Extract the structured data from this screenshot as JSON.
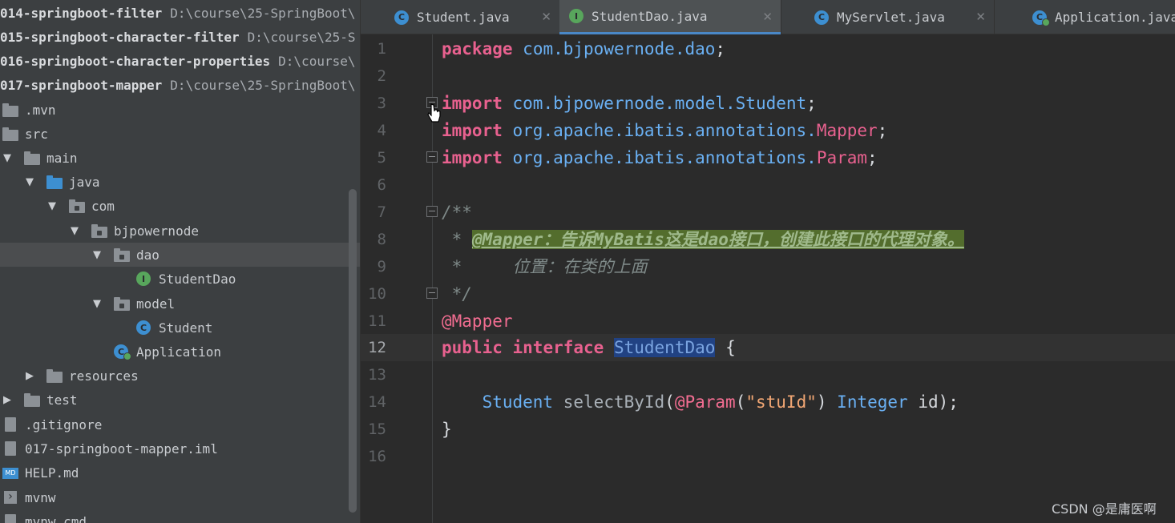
{
  "project_tree": {
    "modules": [
      {
        "name": "014-springboot-filter",
        "path": "D:\\course\\25-SpringBoot\\"
      },
      {
        "name": "015-springboot-character-filter",
        "path": "D:\\course\\25-S"
      },
      {
        "name": "016-springboot-character-properties",
        "path": "D:\\course\\"
      },
      {
        "name": "017-springboot-mapper",
        "path": "D:\\course\\25-SpringBoot\\"
      }
    ],
    "nodes": [
      {
        "label": ".mvn",
        "icon": "folder-icon"
      },
      {
        "label": "src",
        "icon": "folder-icon"
      },
      {
        "label": "main",
        "icon": "folder-icon"
      },
      {
        "label": "java",
        "icon": "source-folder-icon"
      },
      {
        "label": "com",
        "icon": "package-icon"
      },
      {
        "label": "bjpowernode",
        "icon": "package-icon"
      },
      {
        "label": "dao",
        "icon": "package-icon"
      },
      {
        "label": "StudentDao",
        "icon": "interface-icon"
      },
      {
        "label": "model",
        "icon": "package-icon"
      },
      {
        "label": "Student",
        "icon": "class-icon"
      },
      {
        "label": "Application",
        "icon": "spring-app-icon"
      },
      {
        "label": "resources",
        "icon": "resources-folder-icon"
      },
      {
        "label": "test",
        "icon": "folder-icon"
      },
      {
        "label": ".gitignore",
        "icon": "file-icon"
      },
      {
        "label": "017-springboot-mapper.iml",
        "icon": "iml-file-icon"
      },
      {
        "label": "HELP.md",
        "icon": "markdown-icon"
      },
      {
        "label": "mvnw",
        "icon": "terminal-icon"
      },
      {
        "label": "mvnw.cmd",
        "icon": "file-icon"
      }
    ]
  },
  "tabs": [
    {
      "label": "Student.java",
      "icon": "class-icon",
      "active": false
    },
    {
      "label": "StudentDao.java",
      "icon": "interface-icon",
      "active": true
    },
    {
      "label": "MyServlet.java",
      "icon": "class-icon",
      "active": false
    },
    {
      "label": "Application.java",
      "icon": "spring-app-icon",
      "active": false
    }
  ],
  "editor": {
    "line_numbers": [
      "1",
      "2",
      "3",
      "4",
      "5",
      "6",
      "7",
      "8",
      "9",
      "10",
      "11",
      "12",
      "13",
      "14",
      "15",
      "16"
    ],
    "current_line": 12,
    "code": {
      "l1_kw": "package",
      "l1_pkg": "com.bjpowernode.dao",
      "l3_kw": "import",
      "l3_pkg": "com.bjpowernode.model.Student",
      "l4_kw": "import",
      "l4_pkg": "org.apache.ibatis.annotations.",
      "l4_cls": "Mapper",
      "l5_kw": "import",
      "l5_pkg": "org.apache.ibatis.annotations.",
      "l5_cls": "Param",
      "l7": "/**",
      "l8_star": " * ",
      "l8_hl": "@Mapper：告诉MyBatis这是dao接口，创建此接口的代理对象。",
      "l9": " *     位置：在类的上面",
      "l10": " */",
      "l11": "@Mapper",
      "l12_kw1": "public",
      "l12_kw2": "interface",
      "l12_name": "StudentDao",
      "l12_brace": "{",
      "l14_type": "Student",
      "l14_method": "selectById",
      "l14_ann": "@Param",
      "l14_str": "\"stuId\"",
      "l14_type2": "Integer",
      "l14_param": "id",
      "l15": "}"
    }
  },
  "watermark": "CSDN @是庸医啊",
  "colors": {
    "keyword": "#cc7832",
    "package": "#6ab0f3",
    "annotation": "#f26d91",
    "string": "#f2a774",
    "comment": "#7f8a89"
  }
}
